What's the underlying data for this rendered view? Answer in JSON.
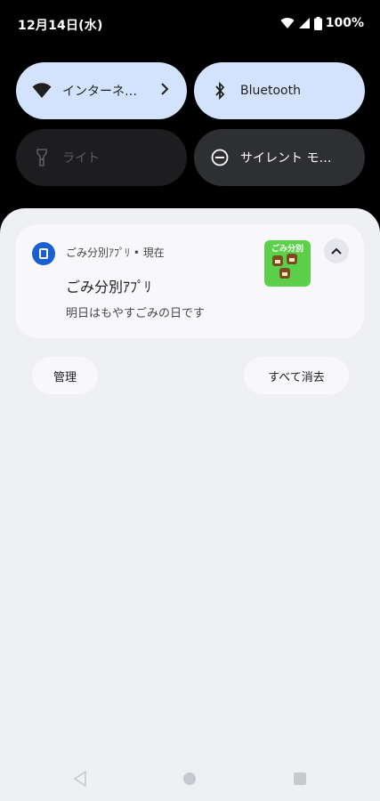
{
  "status_bar": {
    "date": "12月14日(水)",
    "battery": "100%",
    "icons": [
      "wifi-icon",
      "signal-icon",
      "battery-icon"
    ]
  },
  "quick_settings": {
    "tiles": [
      {
        "label": "インターネ…",
        "icon": "wifi-icon",
        "state": "active",
        "has_chevron": true
      },
      {
        "label": "Bluetooth",
        "icon": "bluetooth-icon",
        "state": "active"
      },
      {
        "label": "ライト",
        "icon": "flashlight-icon",
        "state": "inactive"
      },
      {
        "label": "サイレント モ…",
        "icon": "do-not-disturb-icon",
        "state": "dark"
      }
    ]
  },
  "notification": {
    "app_name": "ごみ分別ｱﾌﾟﾘ",
    "time": "現在",
    "header": "ごみ分別ｱﾌﾟﾘ • 現在",
    "title": "ごみ分別ｱﾌﾟﾘ",
    "body": "明日はもやすごみの日です",
    "large_icon_text": "ごみ分別",
    "colors": {
      "app_icon": "#1a5fd1",
      "large_icon": "#5ccf4b"
    }
  },
  "actions": {
    "manage": "管理",
    "clear_all": "すべて消去"
  },
  "navigation": {
    "icons": [
      "back-icon",
      "home-icon",
      "recents-icon"
    ]
  },
  "colors": {
    "background": "#000000",
    "shade": "#eff0f4",
    "tile_active": "#d3e3fd",
    "tile_dark": "#2e2f33"
  }
}
